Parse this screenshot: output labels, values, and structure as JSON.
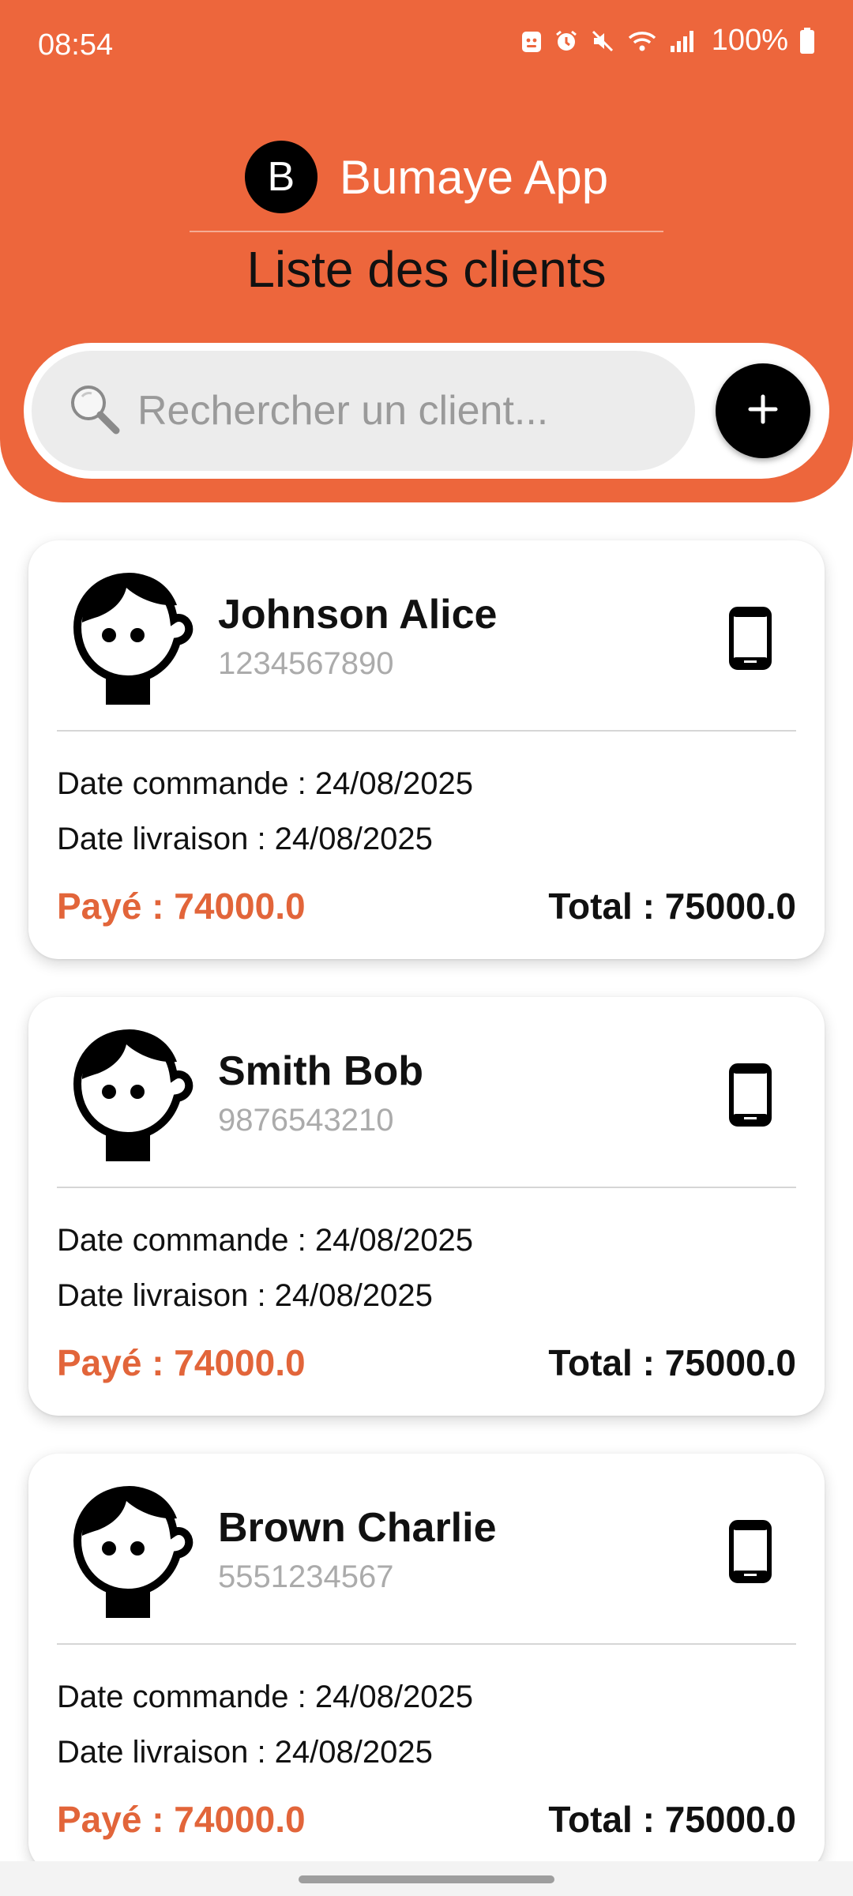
{
  "status_bar": {
    "time": "08:54",
    "battery": "100%",
    "icons": [
      "android-debug-icon",
      "alarm-icon",
      "mute-icon",
      "wifi-icon",
      "signal-icon",
      "battery-icon"
    ]
  },
  "header": {
    "app_initial": "B",
    "app_name": "Bumaye App",
    "title": "Liste des clients"
  },
  "search": {
    "placeholder": "Rechercher un client...",
    "value": ""
  },
  "add_button": {
    "icon": "plus-icon"
  },
  "clients": [
    {
      "name": "Johnson Alice",
      "phone": "1234567890",
      "date_commande": "Date commande : 24/08/2025",
      "date_livraison": "Date livraison : 24/08/2025",
      "paid": "Payé : 74000.0",
      "total": "Total : 75000.0"
    },
    {
      "name": "Smith Bob",
      "phone": "9876543210",
      "date_commande": "Date commande : 24/08/2025",
      "date_livraison": "Date livraison : 24/08/2025",
      "paid": "Payé : 74000.0",
      "total": "Total : 75000.0"
    },
    {
      "name": "Brown Charlie",
      "phone": "5551234567",
      "date_commande": "Date commande : 24/08/2025",
      "date_livraison": "Date livraison : 24/08/2025",
      "paid": "Payé : 74000.0",
      "total": "Total : 75000.0"
    }
  ],
  "colors": {
    "accent": "#ED663C",
    "paid_text": "#E2653A",
    "muted_text": "#ABABAB"
  }
}
